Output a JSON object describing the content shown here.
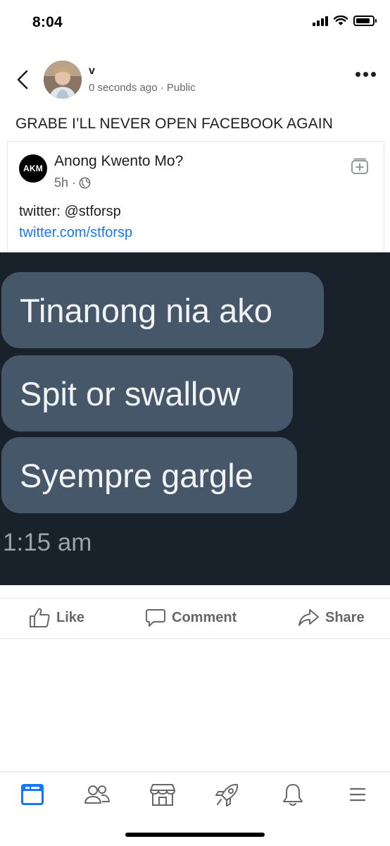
{
  "status_bar": {
    "time": "8:04",
    "icons": [
      "cellular-signal-icon",
      "wifi-icon",
      "battery-icon"
    ]
  },
  "post": {
    "author": "v",
    "meta": "0 seconds ago · Public",
    "text": "GRABE I’LL NEVER OPEN FACEBOOK AGAIN",
    "icons": [
      "back-chevron-icon",
      "more-dots-icon"
    ]
  },
  "shared": {
    "page_avatar_text": "AKM",
    "page_name": "Anong Kwento Mo?",
    "time": "5h ·",
    "text": "twitter: @stforsp",
    "link": "twitter.com/stforsp",
    "icons": [
      "globe-icon",
      "save-add-icon"
    ]
  },
  "image": {
    "messages": [
      "Tinanong nia ako",
      "Spit or swallow",
      "Syempre gargle"
    ],
    "timestamp": "1:15 am"
  },
  "actions": {
    "like": "Like",
    "comment": "Comment",
    "share": "Share"
  },
  "tab_bar": {
    "tabs": [
      "news-feed-icon",
      "friends-icon",
      "marketplace-icon",
      "rocket-icon",
      "notifications-bell-icon",
      "menu-icon"
    ],
    "active_tab": "news-feed-icon"
  },
  "colors": {
    "brand_blue": "#1877f2",
    "text_primary": "#1c1e21",
    "text_secondary": "#65676b",
    "image_background": "#19212b",
    "bubble": "#465769"
  }
}
